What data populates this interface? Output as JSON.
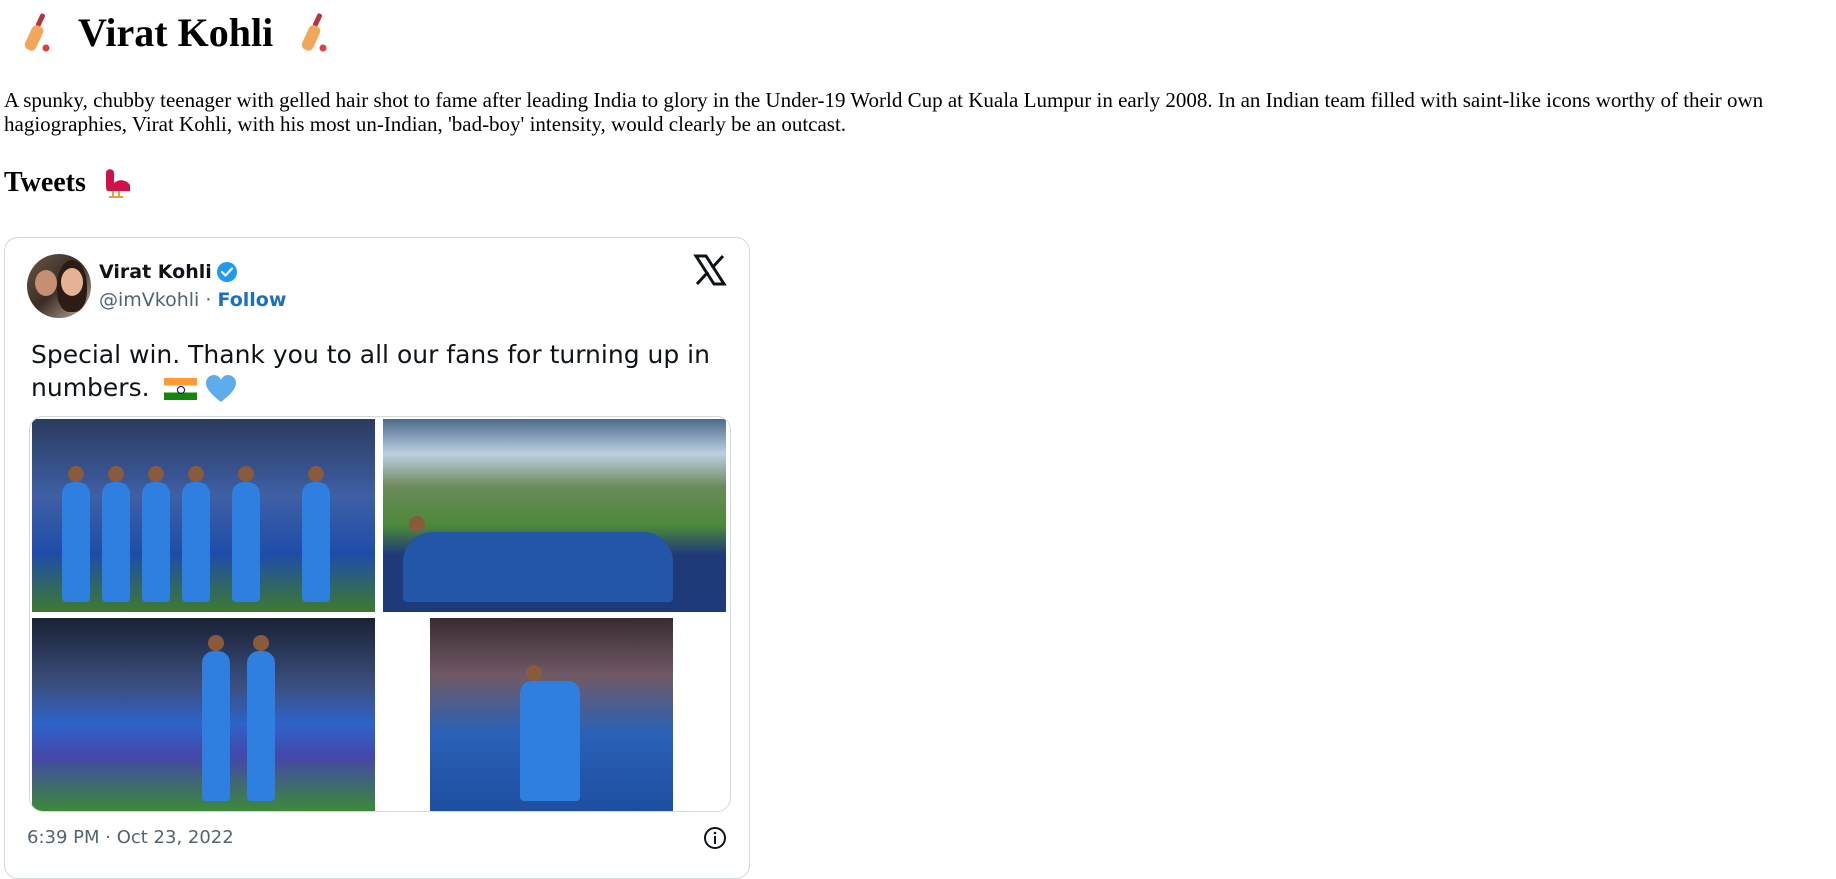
{
  "header": {
    "title": "Virat Kohli",
    "left_icon": "cricket-bat-icon",
    "right_icon": "cricket-bat-icon"
  },
  "intro": {
    "text": "A spunky, chubby teenager with gelled hair shot to fame after leading India to glory in the Under-19 World Cup at Kuala Lumpur in early 2008. In an Indian team filled with saint-like icons worthy of their own hagiographies, Virat Kohli, with his most un-Indian, 'bad-boy' intensity, would clearly be an outcast."
  },
  "tweets_section": {
    "heading": "Tweets",
    "icon": "bird-icon"
  },
  "tweet": {
    "author_name": "Virat Kohli",
    "verified_icon": "verified-badge-icon",
    "handle": "@imVkohli",
    "separator": "·",
    "follow_label": "Follow",
    "platform_icon": "x-logo-icon",
    "text": "Special win. Thank you to all our fans for turning up in numbers.",
    "emojis": [
      "india-flag-icon",
      "blue-heart-icon"
    ],
    "media_count": 4,
    "timestamp": "6:39 PM · Oct 23, 2022",
    "info_icon": "info-icon"
  },
  "colors": {
    "accent_link": "#1d6fc2",
    "verified_blue": "#1d9bf0",
    "muted_text": "#536471",
    "card_border": "#cfd9de",
    "bird_red": "#d0114a"
  }
}
